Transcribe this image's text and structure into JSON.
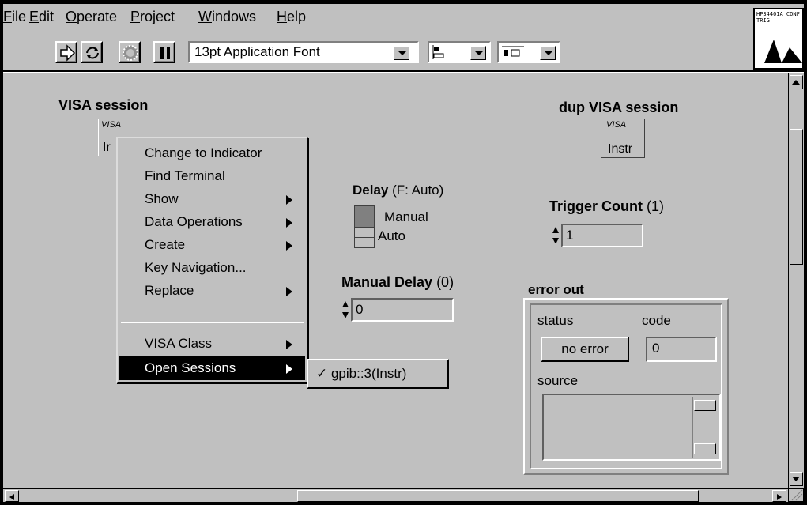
{
  "menubar": {
    "items": [
      {
        "label": "File"
      },
      {
        "label": "Edit"
      },
      {
        "label": "Operate"
      },
      {
        "label": "Project"
      },
      {
        "label": "Windows"
      },
      {
        "label": "Help"
      }
    ]
  },
  "toolbar": {
    "font": "13pt Application Font"
  },
  "vi_icon": {
    "text": "HP34401A CONF TRIG"
  },
  "panel": {
    "visa_session_label": "VISA session",
    "visa_session_value": "Ir",
    "visa_tag": "VISA",
    "dup_visa_label": "dup VISA session",
    "dup_visa_value": "Instr",
    "delay_label": "Delay",
    "delay_default": "(F: Auto)",
    "delay_manual": "Manual",
    "delay_auto": "Auto",
    "trigger_count_label": "Trigger Count",
    "trigger_count_default": "(1)",
    "trigger_count_value": "1",
    "manual_delay_label": "Manual Delay",
    "manual_delay_default": "(0)",
    "manual_delay_value": "0",
    "error_out_label": "error out",
    "status_label": "status",
    "code_label": "code",
    "status_value": "no error",
    "code_value": "0",
    "source_label": "source"
  },
  "context_menu": {
    "items": [
      {
        "label": "Change to Indicator"
      },
      {
        "label": "Find Terminal"
      },
      {
        "label": "Show"
      },
      {
        "label": "Data Operations"
      },
      {
        "label": "Create"
      },
      {
        "label": "Key Navigation..."
      },
      {
        "label": "Replace"
      },
      {
        "label": "VISA Class"
      },
      {
        "label": "Open Sessions"
      }
    ],
    "submenu_item": "✓ gpib::3(Instr)"
  }
}
